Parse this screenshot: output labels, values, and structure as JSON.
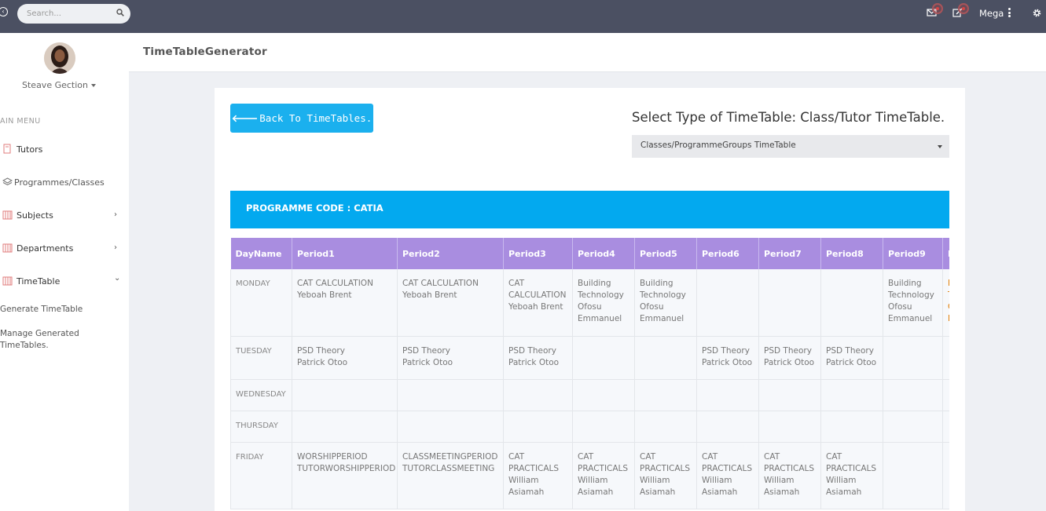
{
  "topbar": {
    "search_placeholder": "Search...",
    "user_label": "Mega",
    "colors": {
      "background": "#4b5062",
      "notification": "#d64545"
    },
    "icons": [
      "back-circle-icon",
      "search-icon",
      "mail-icon",
      "edit-icon",
      "kebab-icon",
      "gear-icon"
    ]
  },
  "sidebar": {
    "profile_name": "Steave Gection",
    "menu_title": "AIN MENU",
    "items": [
      {
        "label": "Tutors",
        "icon": "tutors-icon",
        "chevron": ""
      },
      {
        "label": "Programmes/Classes",
        "icon": "layers-icon",
        "chevron": ""
      },
      {
        "label": "Subjects",
        "icon": "subjects-icon",
        "chevron": "›"
      },
      {
        "label": "Departments",
        "icon": "departments-icon",
        "chevron": "›"
      },
      {
        "label": "TimeTable",
        "icon": "timetable-icon",
        "chevron": "⌄"
      }
    ],
    "sub_items": [
      "Generate TimeTable",
      "Manage Generated TimeTables."
    ]
  },
  "header": {
    "title": "TimeTableGenerator"
  },
  "main": {
    "back_button": "Back To TimeTables.",
    "select_label": "Select Type of TimeTable: Class/Tutor TimeTable.",
    "select_value": "Classes/ProgrammeGroups TimeTable",
    "banner": "PROGRAMME CODE : CATIA",
    "accent_color": "#03a9ef",
    "header_color": "#a98de0"
  },
  "timetable": {
    "headers": [
      "DayName",
      "Period1",
      "Period2",
      "Period3",
      "Period4",
      "Period5",
      "Period6",
      "Period7",
      "Period8",
      "Period9",
      "P"
    ],
    "rows": [
      {
        "day": "MONDAY",
        "cells": [
          [
            "CAT CALCULATION",
            "Yeboah Brent"
          ],
          [
            "CAT CALCULATION",
            "Yeboah Brent"
          ],
          [
            "CAT CALCULATION",
            "Yeboah Brent"
          ],
          [
            "Building Technology",
            "Ofosu Emmanuel"
          ],
          [
            "Building Technology",
            "Ofosu Emmanuel"
          ],
          [],
          [],
          [],
          [
            "Building Technology",
            "Ofosu Emmanuel"
          ],
          [
            "B",
            "T",
            "O",
            "E"
          ]
        ]
      },
      {
        "day": "TUESDAY",
        "cells": [
          [
            "PSD Theory",
            "Patrick Otoo"
          ],
          [
            "PSD Theory",
            "Patrick Otoo"
          ],
          [
            "PSD Theory",
            "Patrick Otoo"
          ],
          [],
          [],
          [
            "PSD Theory",
            "Patrick Otoo"
          ],
          [
            "PSD Theory",
            "Patrick Otoo"
          ],
          [
            "PSD Theory",
            "Patrick Otoo"
          ],
          [],
          []
        ]
      },
      {
        "day": "WEDNESDAY",
        "cells": [
          [],
          [],
          [],
          [],
          [],
          [],
          [],
          [],
          [],
          []
        ]
      },
      {
        "day": "THURSDAY",
        "cells": [
          [],
          [],
          [],
          [],
          [],
          [],
          [],
          [],
          [],
          []
        ]
      },
      {
        "day": "FRIDAY",
        "cells": [
          [
            "WORSHIPPERIOD",
            "TUTORWORSHIPPERIOD"
          ],
          [
            "CLASSMEETINGPERIOD",
            "TUTORCLASSMEETING"
          ],
          [
            "CAT PRACTICALS",
            "William Asiamah"
          ],
          [
            "CAT PRACTICALS",
            "William Asiamah"
          ],
          [
            "CAT PRACTICALS",
            "William Asiamah"
          ],
          [
            "CAT PRACTICALS",
            "William Asiamah"
          ],
          [
            "CAT PRACTICALS",
            "William Asiamah"
          ],
          [
            "CAT PRACTICALS",
            "William Asiamah"
          ],
          [],
          []
        ]
      }
    ]
  }
}
